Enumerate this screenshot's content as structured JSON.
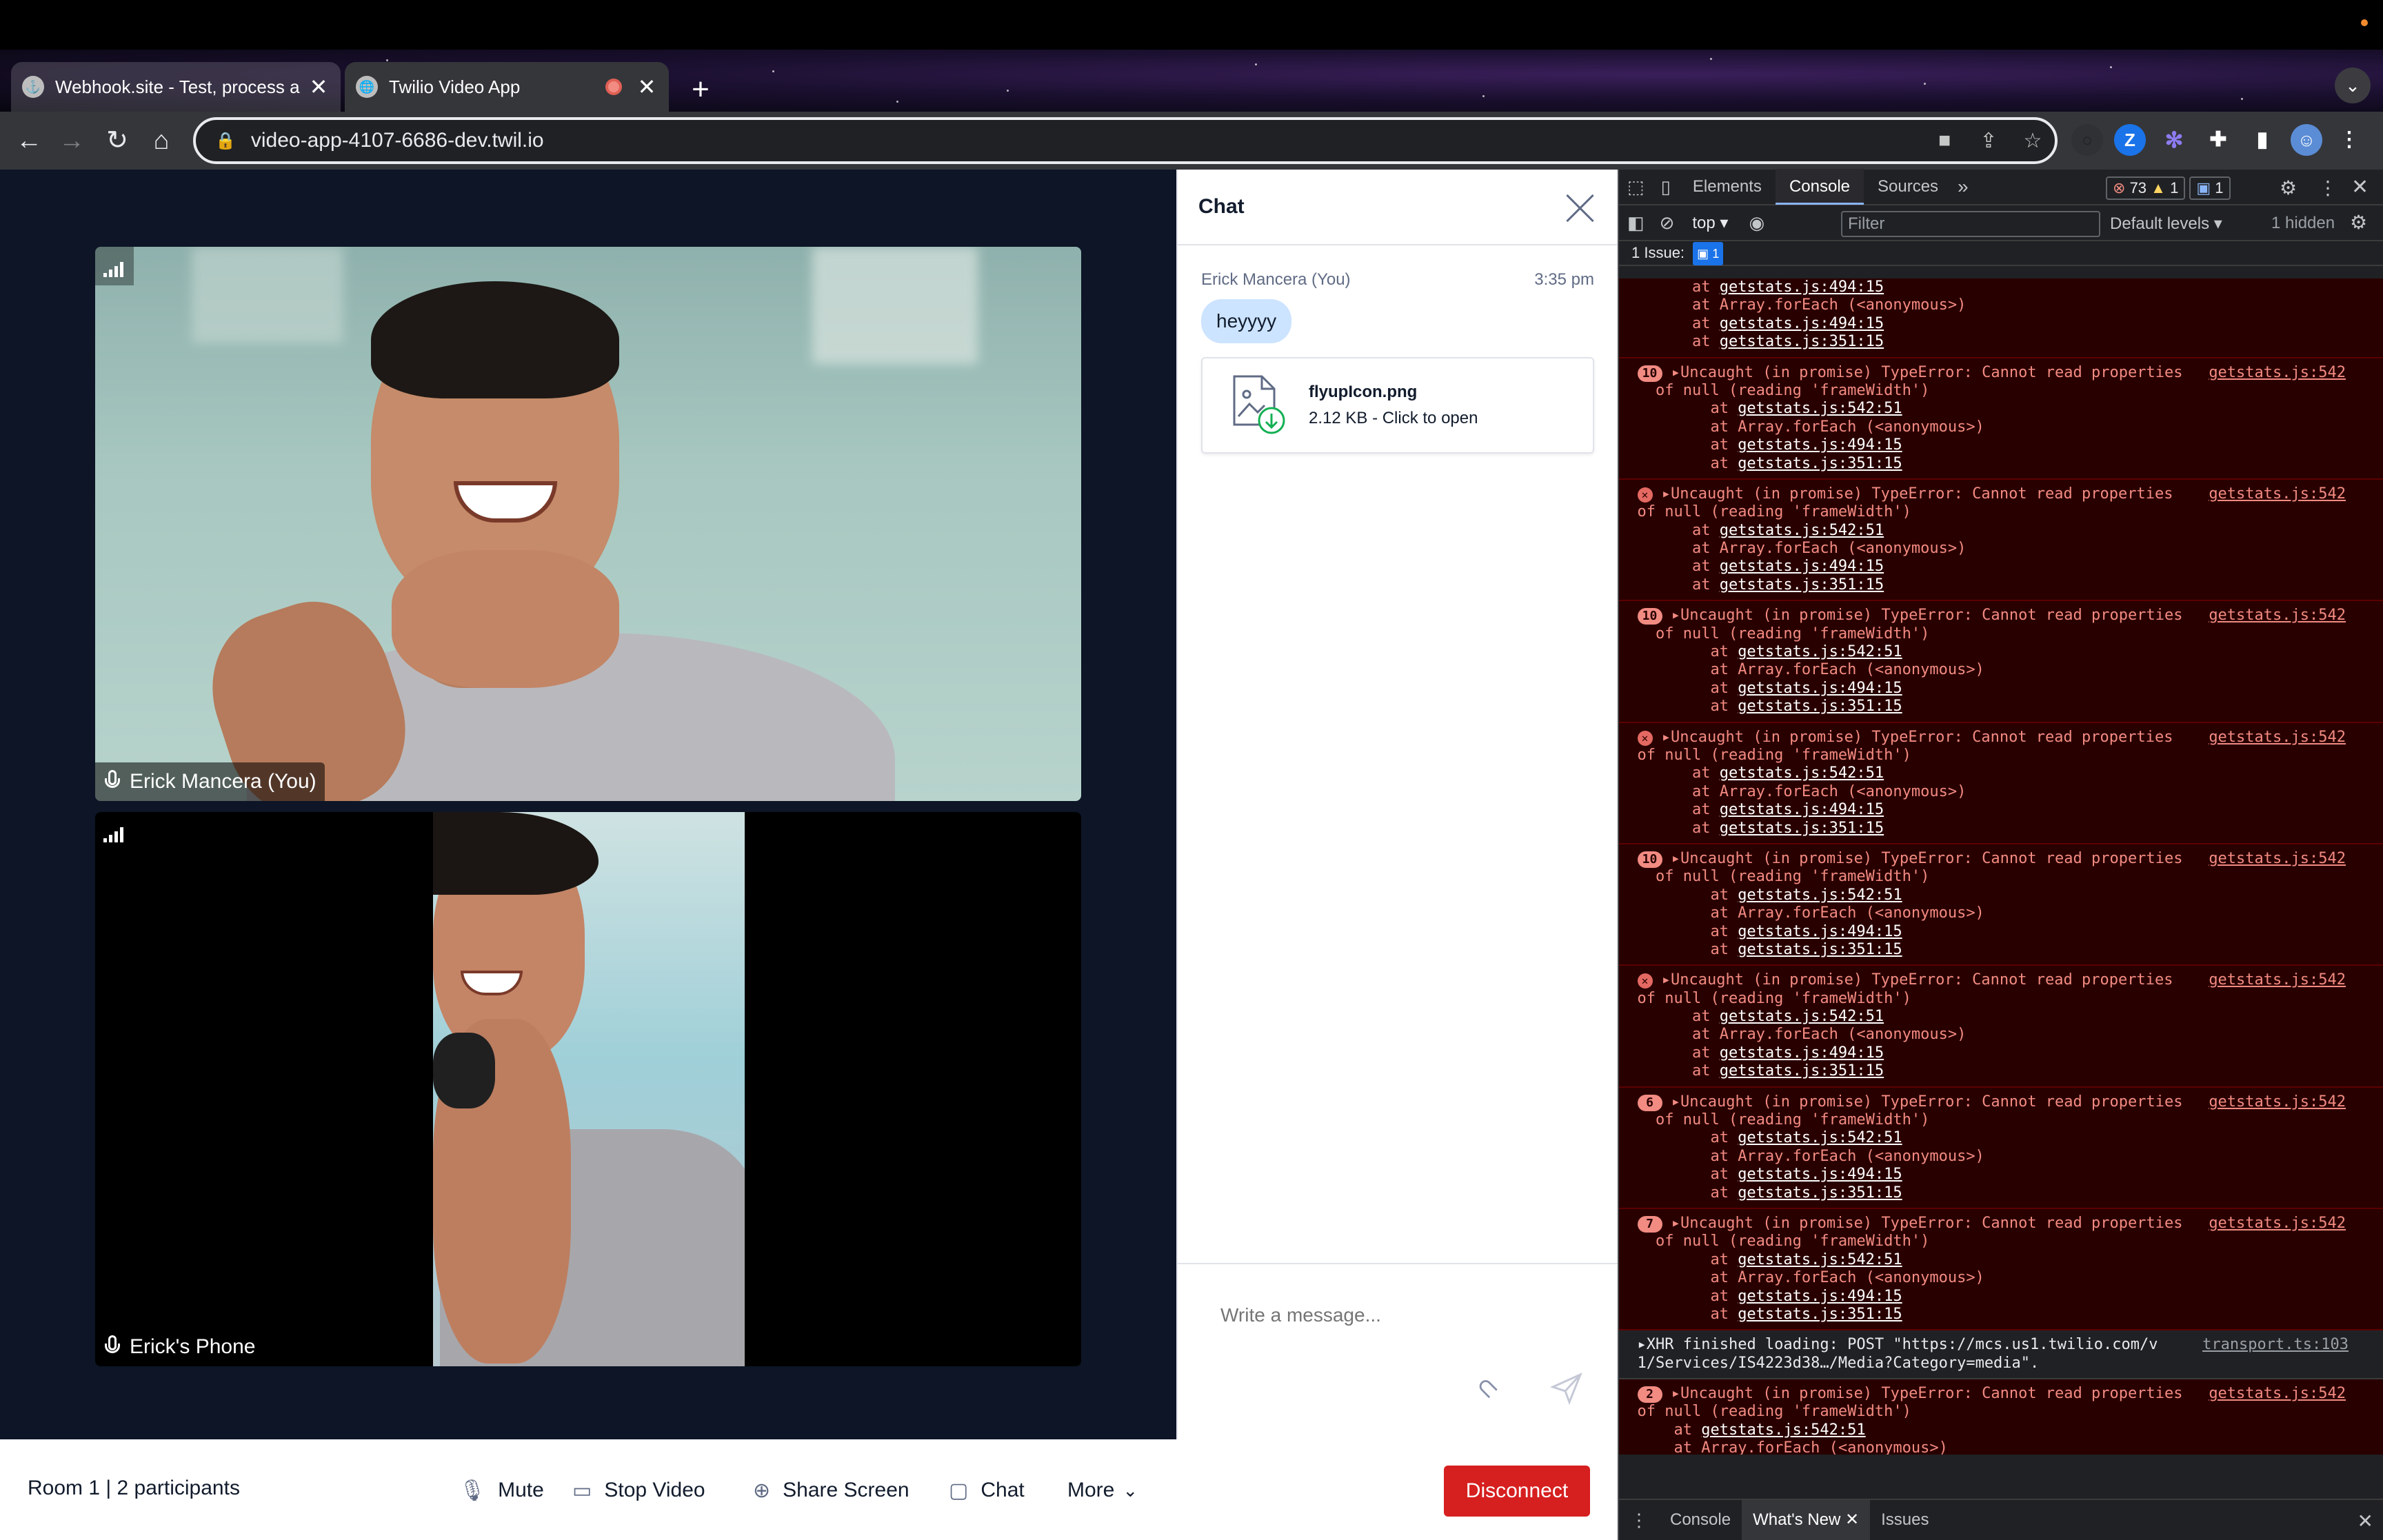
{
  "browser": {
    "tabs": [
      {
        "title": "Webhook.site - Test, process a",
        "close": "✕"
      },
      {
        "title": "Twilio Video App",
        "close": "✕"
      }
    ],
    "new_tab": "+",
    "url": "video-app-4107-6686-dev.twil.io"
  },
  "video": {
    "participants": [
      {
        "name": "Erick Mancera (You)"
      },
      {
        "name": "Erick's Phone"
      }
    ]
  },
  "chat": {
    "title": "Chat",
    "message": {
      "author": "Erick Mancera (You)",
      "time": "3:35 pm",
      "text": "heyyyy"
    },
    "file": {
      "name": "flyupIcon.png",
      "meta": "2.12 KB - Click to open"
    },
    "input_placeholder": "Write a message..."
  },
  "bottombar": {
    "room": "Room 1 | 2 participants",
    "mute": "Mute",
    "stop_video": "Stop Video",
    "share_screen": "Share Screen",
    "chat": "Chat",
    "more": "More",
    "disconnect": "Disconnect"
  },
  "devtools": {
    "tabs": [
      "Elements",
      "Console",
      "Sources",
      "»"
    ],
    "error_count": "73",
    "warning_count": "1",
    "info_count": "1",
    "context": "top",
    "filter_placeholder": "Filter",
    "levels": "Default levels",
    "hidden": "1 hidden",
    "issues_label": "1 Issue:",
    "issues_count": "1",
    "drawer_tabs": [
      "Console",
      "What's New",
      "Issues"
    ],
    "error_line1": "Uncaught (in promise) TypeError: Cannot read properties",
    "error_line2": "of null (reading 'frameWidth')",
    "stack": [
      "getstats.js:542:51",
      "Array.forEach (<anonymous>)",
      "getstats.js:494:15",
      "getstats.js:351:15"
    ],
    "source": "getstats.js:542",
    "entry_badges": [
      "10",
      "x",
      "10",
      "x",
      "10",
      "x",
      "6",
      "7"
    ],
    "xhr_line1": "XHR finished loading: POST \"https://mcs.us1.twilio.com/v",
    "xhr_line2": "1/Services/IS4223d38…/Media?Category=media\".",
    "xhr_source": "transport.ts:103",
    "last_badge": "2"
  }
}
